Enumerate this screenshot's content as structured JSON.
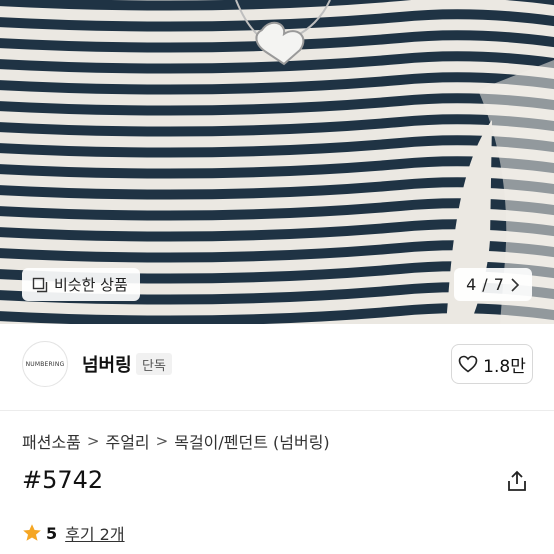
{
  "gallery": {
    "similar_label": "비슷한 상품",
    "current": "4",
    "total": "7",
    "separator": "/",
    "icons": [
      "similar-items-icon",
      "chevron-right-icon"
    ]
  },
  "shop": {
    "logo_text": "NUMBERING",
    "name": "넘버링",
    "badge": "단독",
    "likes": "1.8만",
    "like_icon": "heart-outline-icon"
  },
  "breadcrumb": [
    "패션소품",
    "주얼리",
    "목걸이/펜던트 (넘버링)"
  ],
  "product": {
    "title": "#5742",
    "share_icon": "share-icon"
  },
  "rating": {
    "score": "5",
    "reviews": "후기 2개",
    "star_color": "#f5a623"
  }
}
